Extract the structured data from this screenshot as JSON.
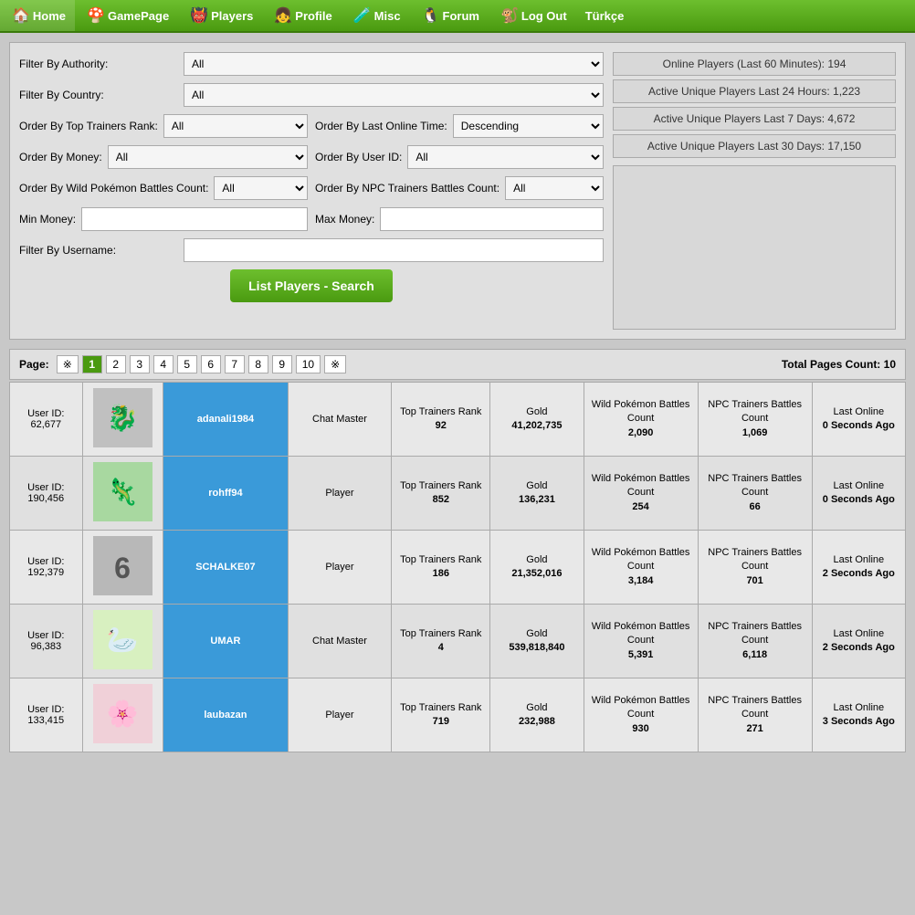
{
  "nav": {
    "items": [
      {
        "label": "Home",
        "icon": "🏠"
      },
      {
        "label": "GamePage",
        "icon": "🍄"
      },
      {
        "label": "Players",
        "icon": "👹"
      },
      {
        "label": "Profile",
        "icon": "👧"
      },
      {
        "label": "Misc",
        "icon": "🧪"
      },
      {
        "label": "Forum",
        "icon": "🐧"
      },
      {
        "label": "Log Out",
        "icon": "🐒"
      },
      {
        "label": "Türkçe",
        "icon": ""
      }
    ]
  },
  "stats": {
    "online_60": "Online Players (Last 60 Minutes): 194",
    "active_24": "Active Unique Players Last 24 Hours: 1,223",
    "active_7": "Active Unique Players Last 7 Days: 4,672",
    "active_30": "Active Unique Players Last 30 Days: 17,150"
  },
  "filters": {
    "authority_label": "Filter By Authority:",
    "authority_value": "All",
    "country_label": "Filter By Country:",
    "country_value": "All",
    "top_trainers_label": "Order By Top Trainers Rank:",
    "top_trainers_value": "All",
    "last_online_label": "Order By Last Online Time:",
    "last_online_value": "Descending",
    "money_label": "Order By Money:",
    "money_value": "All",
    "userid_label": "Order By User ID:",
    "userid_value": "All",
    "wild_label": "Order By Wild Pokémon Battles Count:",
    "wild_value": "All",
    "npc_label": "Order By NPC Trainers Battles Count:",
    "npc_value": "All",
    "min_money_label": "Min Money:",
    "max_money_label": "Max Money:",
    "username_label": "Filter By Username:",
    "search_btn": "List Players - Search"
  },
  "pagination": {
    "label": "Page:",
    "pages": [
      "※",
      "1",
      "2",
      "3",
      "4",
      "5",
      "6",
      "7",
      "8",
      "9",
      "10",
      "※"
    ],
    "active_page": "1",
    "total": "Total Pages Count: 10"
  },
  "table": {
    "players": [
      {
        "userid_label": "User ID:",
        "userid": "62,677",
        "username": "adanali1984",
        "role": "Chat Master",
        "rank_label": "Top Trainers Rank",
        "rank": "92",
        "gold_label": "Gold",
        "gold": "41,202,735",
        "wild_label": "Wild Pokémon Battles Count",
        "wild": "2,090",
        "npc_label": "NPC Trainers Battles Count",
        "npc": "1,069",
        "online_label": "Last Online",
        "online": "0 Seconds Ago",
        "avatar_color": "#c8c8c8",
        "avatar_emoji": "🐉"
      },
      {
        "userid_label": "User ID:",
        "userid": "190,456",
        "username": "rohff94",
        "role": "Player",
        "rank_label": "Top Trainers Rank",
        "rank": "852",
        "gold_label": "Gold",
        "gold": "136,231",
        "wild_label": "Wild Pokémon Battles Count",
        "wild": "254",
        "npc_label": "NPC Trainers Battles Count",
        "npc": "66",
        "online_label": "Last Online",
        "online": "0 Seconds Ago",
        "avatar_color": "#a8d8a0",
        "avatar_emoji": "🦎"
      },
      {
        "userid_label": "User ID:",
        "userid": "192,379",
        "username": "SCHALKE07",
        "role": "Player",
        "rank_label": "Top Trainers Rank",
        "rank": "186",
        "gold_label": "Gold",
        "gold": "21,352,016",
        "wild_label": "Wild Pokémon Battles Count",
        "wild": "3,184",
        "npc_label": "NPC Trainers Battles Count",
        "npc": "701",
        "online_label": "Last Online",
        "online": "2 Seconds Ago",
        "avatar_color": "#c0c0c0",
        "avatar_emoji": "6"
      },
      {
        "userid_label": "User ID:",
        "userid": "96,383",
        "username": "UMAR",
        "role": "Chat Master",
        "rank_label": "Top Trainers Rank",
        "rank": "4",
        "gold_label": "Gold",
        "gold": "539,818,840",
        "wild_label": "Wild Pokémon Battles Count",
        "wild": "5,391",
        "npc_label": "NPC Trainers Battles Count",
        "npc": "6,118",
        "online_label": "Last Online",
        "online": "2 Seconds Ago",
        "avatar_color": "#d8f0c0",
        "avatar_emoji": "🦢"
      },
      {
        "userid_label": "User ID:",
        "userid": "133,415",
        "username": "laubazan",
        "role": "Player",
        "rank_label": "Top Trainers Rank",
        "rank": "719",
        "gold_label": "Gold",
        "gold": "232,988",
        "wild_label": "Wild Pokémon Battles Count",
        "wild": "930",
        "npc_label": "NPC Trainers Battles Count",
        "npc": "271",
        "online_label": "Last Online",
        "online": "3 Seconds Ago",
        "avatar_color": "#f0d0d8",
        "avatar_emoji": "🌸"
      }
    ]
  }
}
